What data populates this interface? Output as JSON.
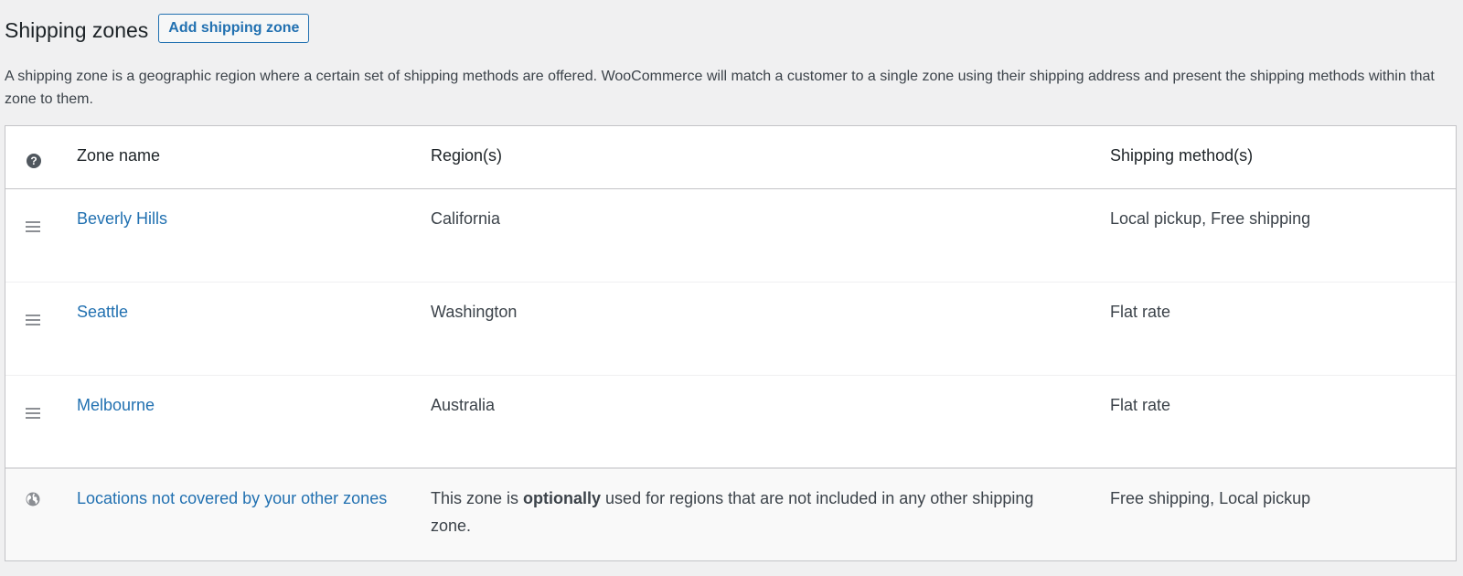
{
  "header": {
    "title": "Shipping zones",
    "add_button": "Add shipping zone"
  },
  "description": "A shipping zone is a geographic region where a certain set of shipping methods are offered. WooCommerce will match a customer to a single zone using their shipping address and present the shipping methods within that zone to them.",
  "table": {
    "columns": {
      "help_icon": "help-icon",
      "zone_name": "Zone name",
      "regions": "Region(s)",
      "methods": "Shipping method(s)"
    },
    "zones": [
      {
        "name": "Beverly Hills",
        "region": "California",
        "methods": "Local pickup, Free shipping",
        "icon": "drag-handle-icon"
      },
      {
        "name": "Seattle",
        "region": "Washington",
        "methods": "Flat rate",
        "icon": "drag-handle-icon"
      },
      {
        "name": "Melbourne",
        "region": "Australia",
        "methods": "Flat rate",
        "icon": "drag-handle-icon"
      }
    ],
    "rest_of_world": {
      "name": "Locations not covered by your other zones",
      "region_prefix": "This zone is ",
      "region_bold": "optionally",
      "region_suffix": " used for regions that are not included in any other shipping zone.",
      "methods": "Free shipping, Local pickup",
      "icon": "globe-icon"
    }
  },
  "colors": {
    "link": "#2271b1",
    "background": "#f0f0f1",
    "text": "#3c434a"
  }
}
